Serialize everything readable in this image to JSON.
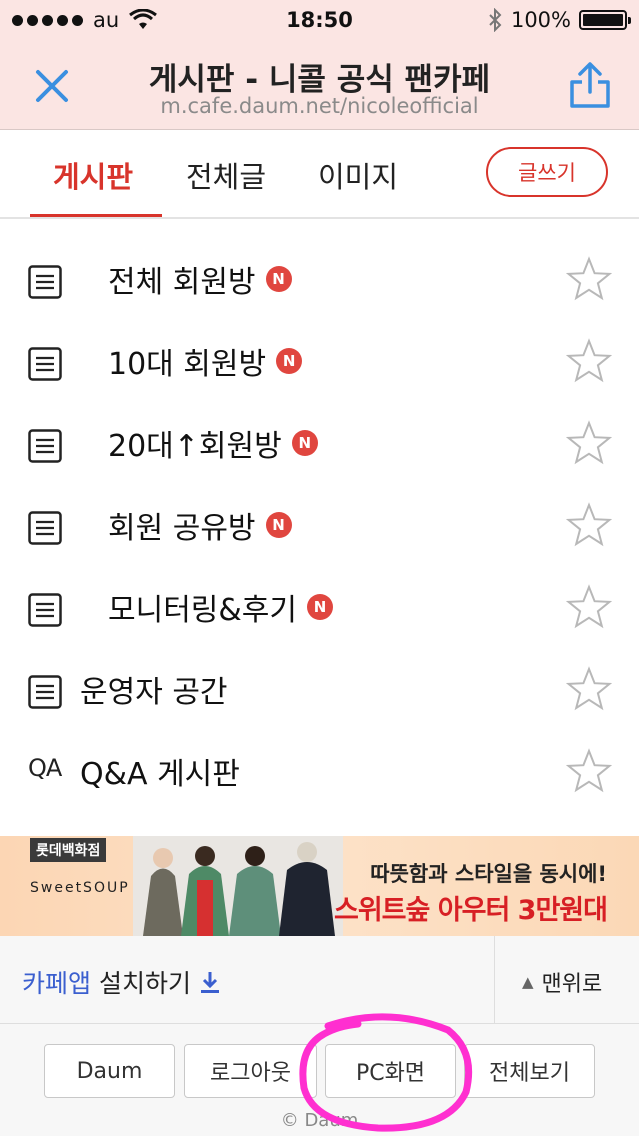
{
  "status_bar": {
    "carrier": "au",
    "time": "18:50",
    "battery": "100%",
    "battery_level": 1.0
  },
  "header": {
    "title": "게시판 - 니콜 공식 팬카페",
    "url": "m.cafe.daum.net/nicoleofficial"
  },
  "tabs": [
    {
      "label": "게시판",
      "active": true
    },
    {
      "label": "전체글",
      "active": false
    },
    {
      "label": "이미지",
      "active": false
    }
  ],
  "write_button": "글쓰기",
  "boards": [
    {
      "label": "전체 회원방",
      "badge": "N",
      "icon": "document-icon"
    },
    {
      "label": "10대 회원방",
      "badge": "N",
      "icon": "document-icon"
    },
    {
      "label": "20대↑회원방",
      "badge": "N",
      "icon": "document-icon"
    },
    {
      "label": "회원 공유방",
      "badge": "N",
      "icon": "document-icon"
    },
    {
      "label": "모니터링&후기",
      "badge": "N",
      "icon": "document-icon"
    },
    {
      "label": "운영자 공간",
      "badge": "",
      "icon": "document-icon"
    },
    {
      "label": "Q&A 게시판",
      "badge": "",
      "icon": "qa-icon",
      "icon_text": "QA"
    }
  ],
  "ad": {
    "tag": "롯데백화점",
    "brand": "SweetSOUP",
    "line1": "따뜻함과 스타일을 동시에!",
    "line2": "스위트숲 아우터 3만원대"
  },
  "install_bar": {
    "app_link_highlight": "카페앱",
    "app_link_text": "설치하기",
    "to_top": "맨위로"
  },
  "footer": {
    "buttons": [
      "Daum",
      "로그아웃",
      "PC화면",
      "전체보기"
    ],
    "copyright": "© Daum"
  },
  "colors": {
    "accent": "#d8342b",
    "header_bg": "#fbe5e3",
    "link_blue": "#3b5fcf",
    "annotation_pink": "#ff2fd0"
  }
}
